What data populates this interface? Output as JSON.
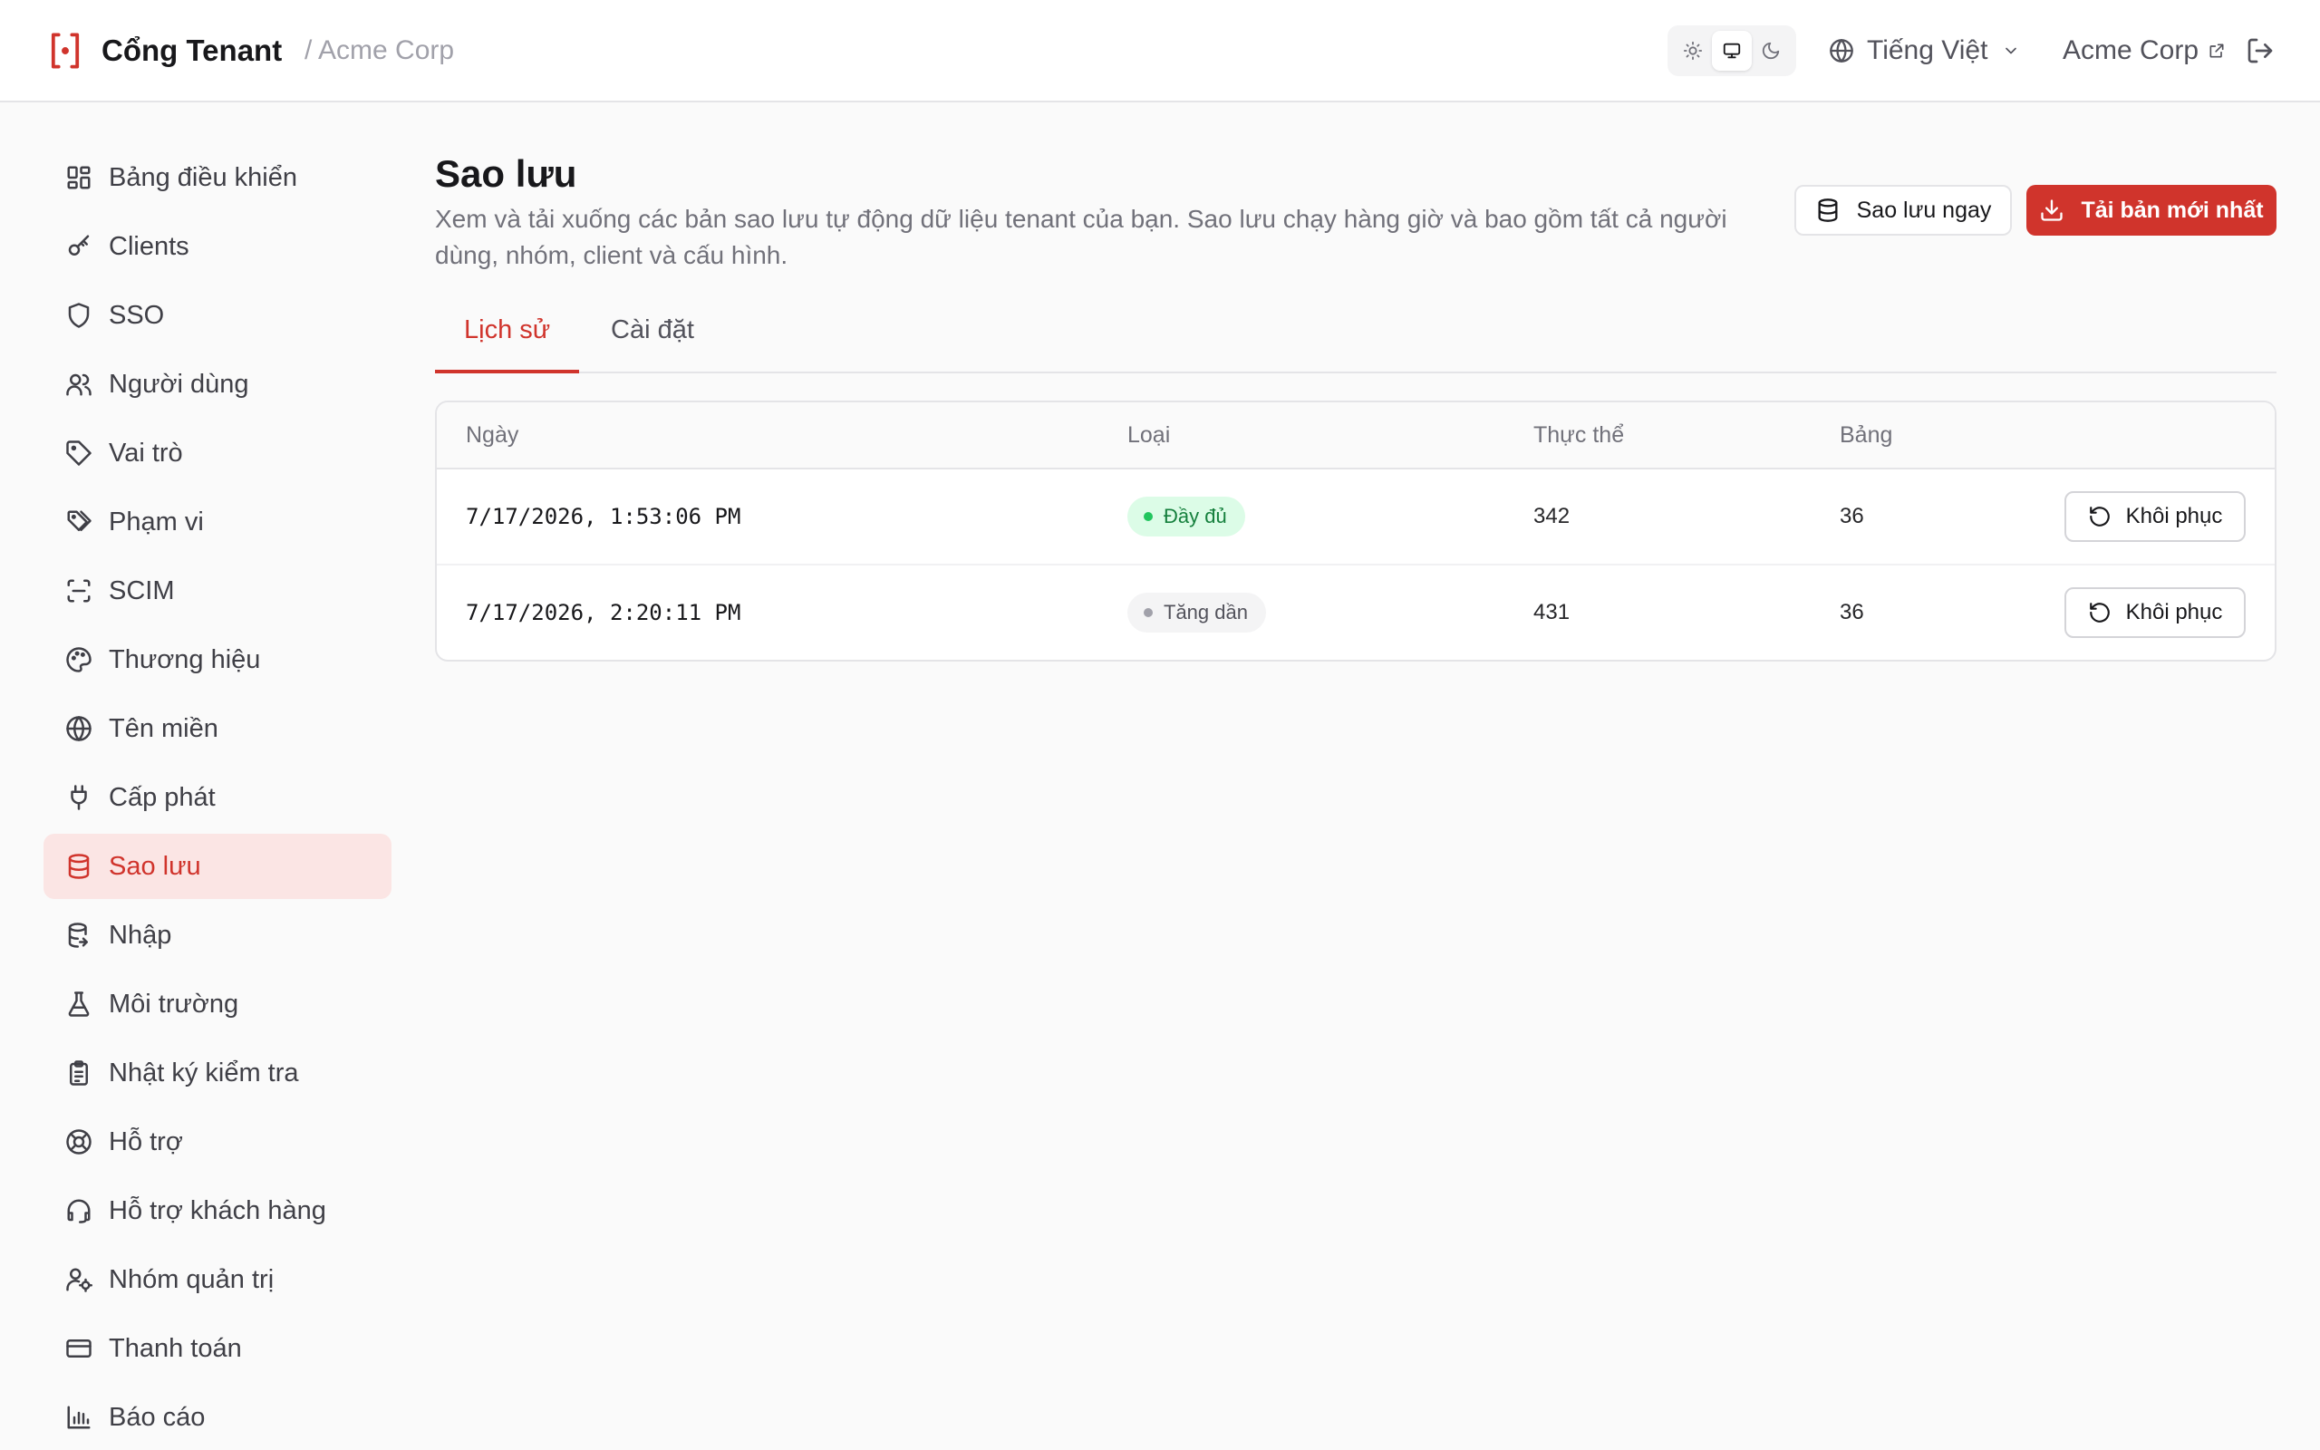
{
  "header": {
    "brand": "Cổng Tenant",
    "breadcrumb": "/ Acme Corp",
    "language": "Tiếng Việt",
    "org": "Acme Corp",
    "theme_options": [
      "sun-icon",
      "monitor-icon",
      "moon-icon"
    ],
    "theme_selected": "monitor-icon"
  },
  "sidebar": {
    "items": [
      {
        "label": "Bảng điều khiển",
        "icon": "dashboard-icon"
      },
      {
        "label": "Clients",
        "icon": "key-icon"
      },
      {
        "label": "SSO",
        "icon": "shield-icon"
      },
      {
        "label": "Người dùng",
        "icon": "users-icon"
      },
      {
        "label": "Vai trò",
        "icon": "tag-icon"
      },
      {
        "label": "Phạm vi",
        "icon": "tags-icon"
      },
      {
        "label": "SCIM",
        "icon": "scan-icon"
      },
      {
        "label": "Thương hiệu",
        "icon": "palette-icon"
      },
      {
        "label": "Tên miền",
        "icon": "globe-icon"
      },
      {
        "label": "Cấp phát",
        "icon": "plug-icon"
      },
      {
        "label": "Sao lưu",
        "icon": "database-icon",
        "active": true
      },
      {
        "label": "Nhập",
        "icon": "database-import-icon"
      },
      {
        "label": "Môi trường",
        "icon": "flask-icon"
      },
      {
        "label": "Nhật ký kiểm tra",
        "icon": "clipboard-icon"
      },
      {
        "label": "Hỗ trợ",
        "icon": "lifebuoy-icon"
      },
      {
        "label": "Hỗ trợ khách hàng",
        "icon": "headset-icon"
      },
      {
        "label": "Nhóm quản trị",
        "icon": "user-cog-icon"
      },
      {
        "label": "Thanh toán",
        "icon": "credit-card-icon"
      },
      {
        "label": "Báo cáo",
        "icon": "bar-chart-icon"
      }
    ]
  },
  "page": {
    "title": "Sao lưu",
    "description": "Xem và tải xuống các bản sao lưu tự động dữ liệu tenant của bạn. Sao lưu chạy hàng giờ và bao gồm tất cả người dùng, nhóm, client và cấu hình.",
    "backup_now": "Sao lưu ngay",
    "download_latest": "Tải bản mới nhất"
  },
  "tabs": [
    {
      "label": "Lịch sử",
      "active": true
    },
    {
      "label": "Cài đặt",
      "active": false
    }
  ],
  "table": {
    "columns": [
      "Ngày",
      "Loại",
      "Thực thể",
      "Bảng"
    ],
    "rows": [
      {
        "date": "7/17/2026, 1:53:06 PM",
        "type": "Đầy đủ",
        "type_kind": "full",
        "entities": "342",
        "tables": "36",
        "action": "Khôi phục"
      },
      {
        "date": "7/17/2026, 2:20:11 PM",
        "type": "Tăng dần",
        "type_kind": "incremental",
        "entities": "431",
        "tables": "36",
        "action": "Khôi phục"
      }
    ]
  },
  "colors": {
    "accent": "#d0342c",
    "accent_soft": "#fbe5e4",
    "success": "#22c55e"
  }
}
